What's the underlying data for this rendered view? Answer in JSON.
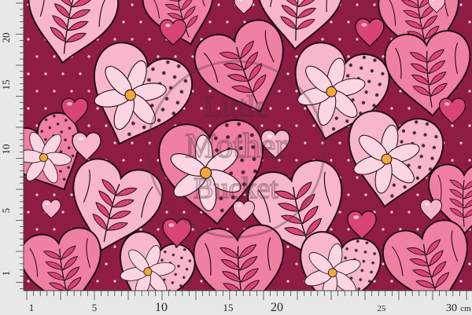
{
  "colors": {
    "background": "#8e1c45",
    "heart_light": "#f7b6cc",
    "heart_mid": "#ef7fa3",
    "heart_deep": "#d94477",
    "outline": "#1f0a12",
    "dot": "#f6cdd9",
    "ruler_bg": "#e8e8e8",
    "flower_center": "#f2a83a"
  },
  "watermark": {
    "line1": "Little",
    "line2": "Mother",
    "line3": "Bucket"
  },
  "ruler_left": {
    "labels": [
      "20",
      "15",
      "10",
      "5",
      "1"
    ]
  },
  "ruler_bottom": {
    "labels": [
      "1",
      "5",
      "10",
      "15",
      "20",
      "25",
      "30"
    ],
    "unit": "cm"
  }
}
